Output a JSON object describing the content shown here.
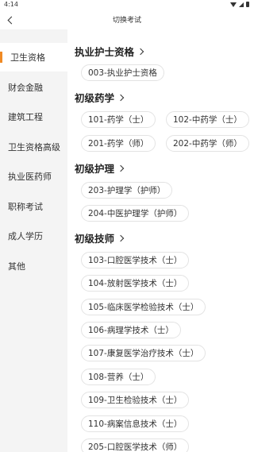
{
  "status": {
    "time": "4:14"
  },
  "header": {
    "title": "切换考试"
  },
  "sidebar": {
    "items": [
      {
        "label": "卫生资格"
      },
      {
        "label": "财会金融"
      },
      {
        "label": "建筑工程"
      },
      {
        "label": "卫生资格高级"
      },
      {
        "label": "执业医药师"
      },
      {
        "label": "职称考试"
      },
      {
        "label": "成人学历"
      },
      {
        "label": "其他"
      }
    ],
    "active_index": 0
  },
  "sections": [
    {
      "title": "执业护士资格",
      "chips": [
        "003-执业护士资格"
      ]
    },
    {
      "title": "初级药学",
      "chips": [
        "101-药学（士）",
        "102-中药学（士）",
        "201-药学（师）",
        "202-中药学（师）"
      ]
    },
    {
      "title": "初级护理",
      "chips": [
        "203-护理学（护师）",
        "204-中医护理学（护师）"
      ]
    },
    {
      "title": "初级技师",
      "chips": [
        "103-口腔医学技术（士）",
        "104-放射医学技术（士）",
        "105-临床医学检验技术（士）",
        "106-病理学技术（士）",
        "107-康复医学治疗技术（士）",
        "108-营养（士）",
        "109-卫生检验技术（士）",
        "110-病案信息技术（士）",
        "205-口腔医学技术（师）"
      ]
    }
  ],
  "colors": {
    "accent": "#f08a24",
    "sidebar_bg": "#f4f4f4",
    "chip_border": "#e3e3e3"
  }
}
